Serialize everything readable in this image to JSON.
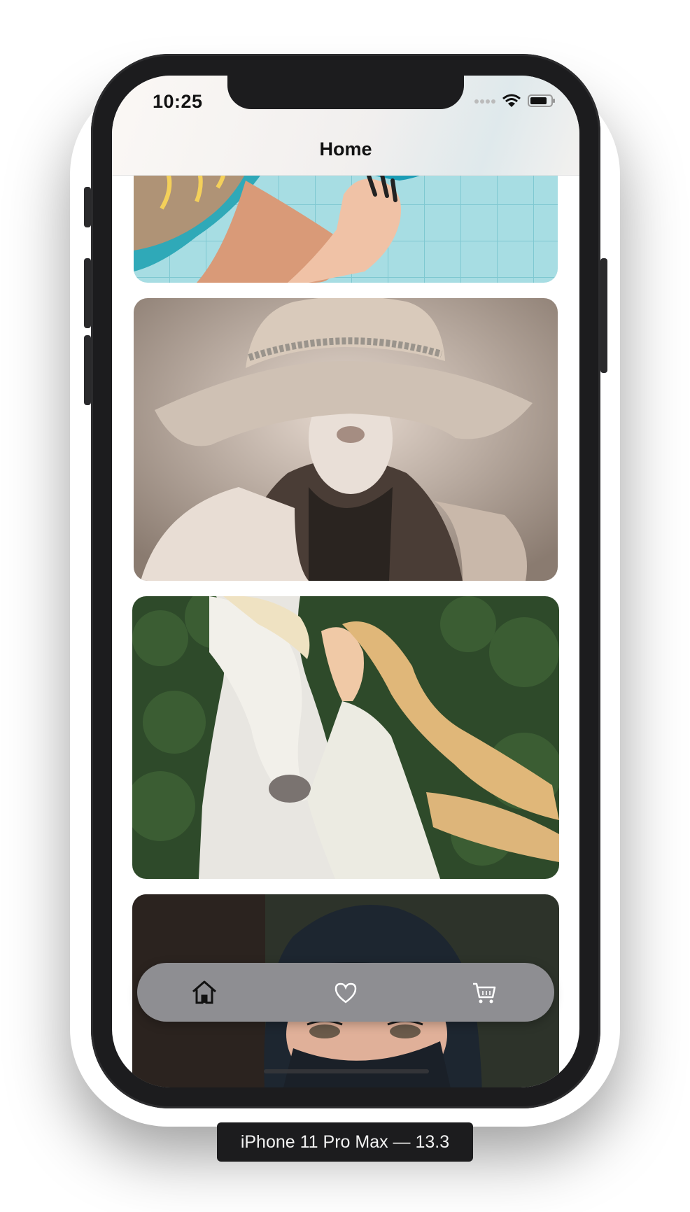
{
  "status_bar": {
    "time": "10:25"
  },
  "nav": {
    "title": "Home"
  },
  "cards": [
    {
      "name": "photo-woman-blue-hair-pool"
    },
    {
      "name": "photo-woman-wide-brim-hat"
    },
    {
      "name": "photo-woman-white-horse"
    },
    {
      "name": "photo-woman-hijab-eyes"
    }
  ],
  "tab_bar": {
    "items": [
      {
        "icon": "home-icon"
      },
      {
        "icon": "heart-icon"
      },
      {
        "icon": "cart-icon"
      }
    ]
  },
  "device_label": "iPhone 11 Pro Max — 13.3",
  "colors": {
    "device_frame": "#1c1c1e",
    "tab_bar": "#8e8e92",
    "screen_bg": "#ffffff"
  }
}
